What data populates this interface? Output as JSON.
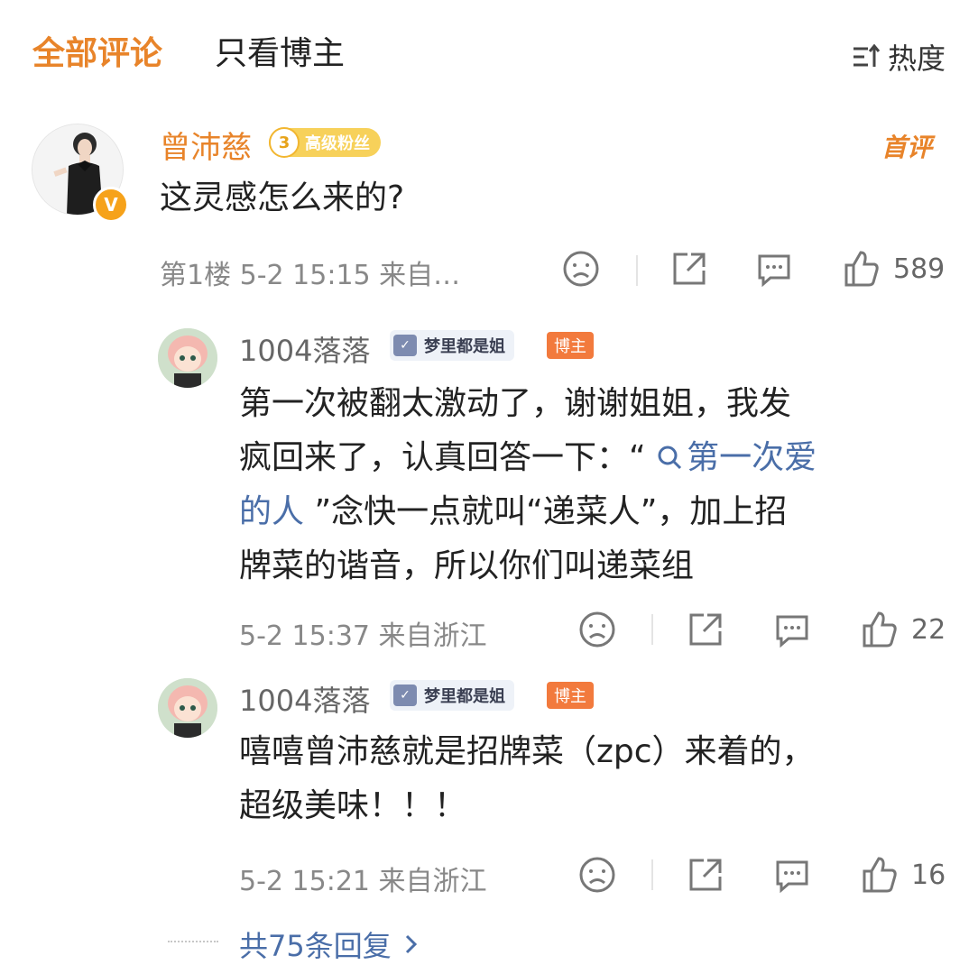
{
  "header": {
    "tab_all": "全部评论",
    "tab_blogger": "只看博主",
    "sort_label": "热度"
  },
  "main_comment": {
    "username": "曾沛慈",
    "fan_level": "3",
    "fan_badge": "高级粉丝",
    "first_tag": "首评",
    "verified_badge": "V",
    "content": "这灵感怎么来的?",
    "meta": "第1楼 5-2 15:15 来自…",
    "likes": "589"
  },
  "replies": [
    {
      "username": "1004落落",
      "group_badge": "梦里都是姐",
      "role_tag": "博主",
      "content_lines": {
        "line1": "第一次被翻太激动了，谢谢姐姐，我发",
        "line2_pre": "疯回来了，认真回答一下：“ ",
        "line2_link": "第一次爱",
        "line3_link": "的人",
        "line3_post": " ”念快一点就叫“递菜人”，加上招",
        "line4": "牌菜的谐音，所以你们叫递菜组"
      },
      "meta": "5-2 15:37 来自浙江",
      "likes": "22"
    },
    {
      "username": "1004落落",
      "group_badge": "梦里都是姐",
      "role_tag": "博主",
      "content_lines": {
        "line1": "嘻嘻曾沛慈就是招牌菜（zpc）来着的，",
        "line2": "超级美味！！！"
      },
      "meta": "5-2 15:21 来自浙江",
      "likes": "16"
    }
  ],
  "footer": {
    "more_replies": "共75条回复"
  },
  "colors": {
    "accent_orange": "#e8842a",
    "link_blue": "#4a6ea8",
    "meta_gray": "#888888"
  }
}
